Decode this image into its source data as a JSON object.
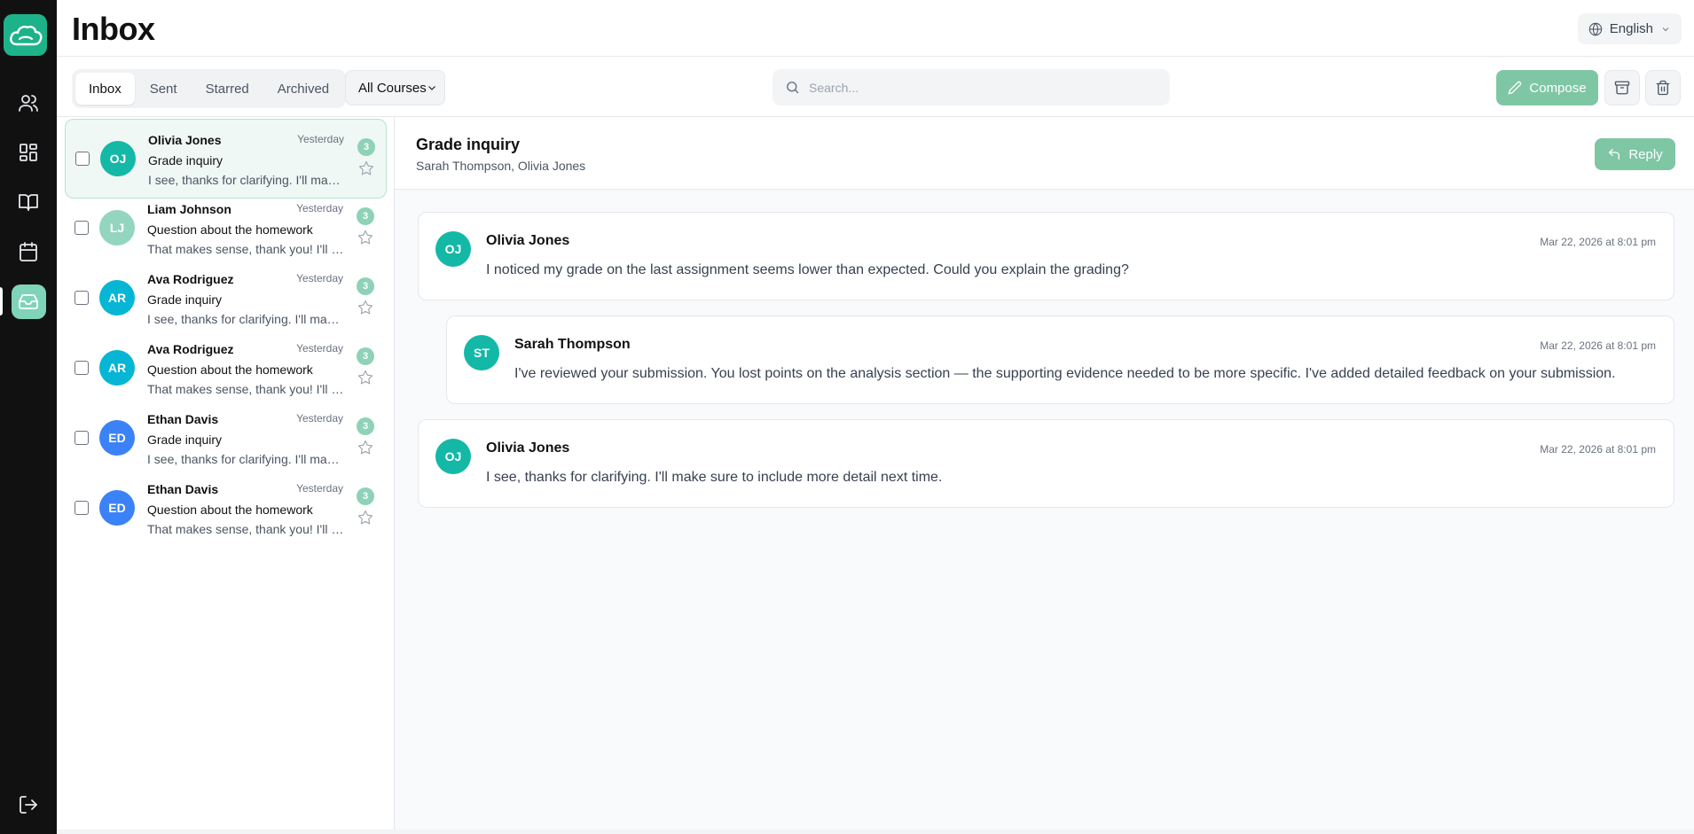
{
  "app": {
    "title": "Inbox",
    "language": "English"
  },
  "rail": {
    "items": [
      "users-icon",
      "dashboard-icon",
      "book-icon",
      "calendar-icon",
      "inbox-icon"
    ],
    "active": "inbox-icon",
    "logout": "logout-icon"
  },
  "toolbar": {
    "tabs": [
      {
        "label": "Inbox",
        "active": true
      },
      {
        "label": "Sent",
        "active": false
      },
      {
        "label": "Starred",
        "active": false
      },
      {
        "label": "Archived",
        "active": false
      }
    ],
    "course_filter": "All Courses",
    "search_placeholder": "Search...",
    "compose_label": "Compose"
  },
  "threads": [
    {
      "initials": "OJ",
      "name": "Olivia Jones",
      "time": "Yesterday",
      "subject": "Grade inquiry",
      "preview": "I see, thanks for clarifying. I'll make sure to include more detail next time.",
      "count": "3",
      "color": "#14b8a6",
      "selected": true
    },
    {
      "initials": "LJ",
      "name": "Liam Johnson",
      "time": "Yesterday",
      "subject": "Question about the homework",
      "preview": "That makes sense, thank you! I'll try that approach.",
      "count": "3",
      "color": "#93d5bf",
      "selected": false
    },
    {
      "initials": "AR",
      "name": "Ava Rodriguez",
      "time": "Yesterday",
      "subject": "Grade inquiry",
      "preview": "I see, thanks for clarifying. I'll make sure to include more detail next time.",
      "count": "3",
      "color": "#06b6d4",
      "selected": false
    },
    {
      "initials": "AR",
      "name": "Ava Rodriguez",
      "time": "Yesterday",
      "subject": "Question about the homework",
      "preview": "That makes sense, thank you! I'll try that approach.",
      "count": "3",
      "color": "#06b6d4",
      "selected": false
    },
    {
      "initials": "ED",
      "name": "Ethan Davis",
      "time": "Yesterday",
      "subject": "Grade inquiry",
      "preview": "I see, thanks for clarifying. I'll make sure to include more detail next time.",
      "count": "3",
      "color": "#3b82f6",
      "selected": false
    },
    {
      "initials": "ED",
      "name": "Ethan Davis",
      "time": "Yesterday",
      "subject": "Question about the homework",
      "preview": "That makes sense, thank you! I'll try that approach.",
      "count": "3",
      "color": "#3b82f6",
      "selected": false
    }
  ],
  "detail": {
    "subject": "Grade inquiry",
    "participants": "Sarah Thompson, Olivia Jones",
    "reply_label": "Reply",
    "messages": [
      {
        "initials": "OJ",
        "sender": "Olivia Jones",
        "time": "Mar 22, 2026 at 8:01 pm",
        "body": "I noticed my grade on the last assignment seems lower than expected. Could you explain the grading?",
        "color": "#14b8a6",
        "indent": false
      },
      {
        "initials": "ST",
        "sender": "Sarah Thompson",
        "time": "Mar 22, 2026 at 8:01 pm",
        "body": "I've reviewed your submission. You lost points on the analysis section — the supporting evidence needed to be more specific. I've added detailed feedback on your submission.",
        "color": "#14b8a6",
        "indent": true
      },
      {
        "initials": "OJ",
        "sender": "Olivia Jones",
        "time": "Mar 22, 2026 at 8:01 pm",
        "body": "I see, thanks for clarifying. I'll make sure to include more detail next time.",
        "color": "#14b8a6",
        "indent": false
      }
    ]
  }
}
